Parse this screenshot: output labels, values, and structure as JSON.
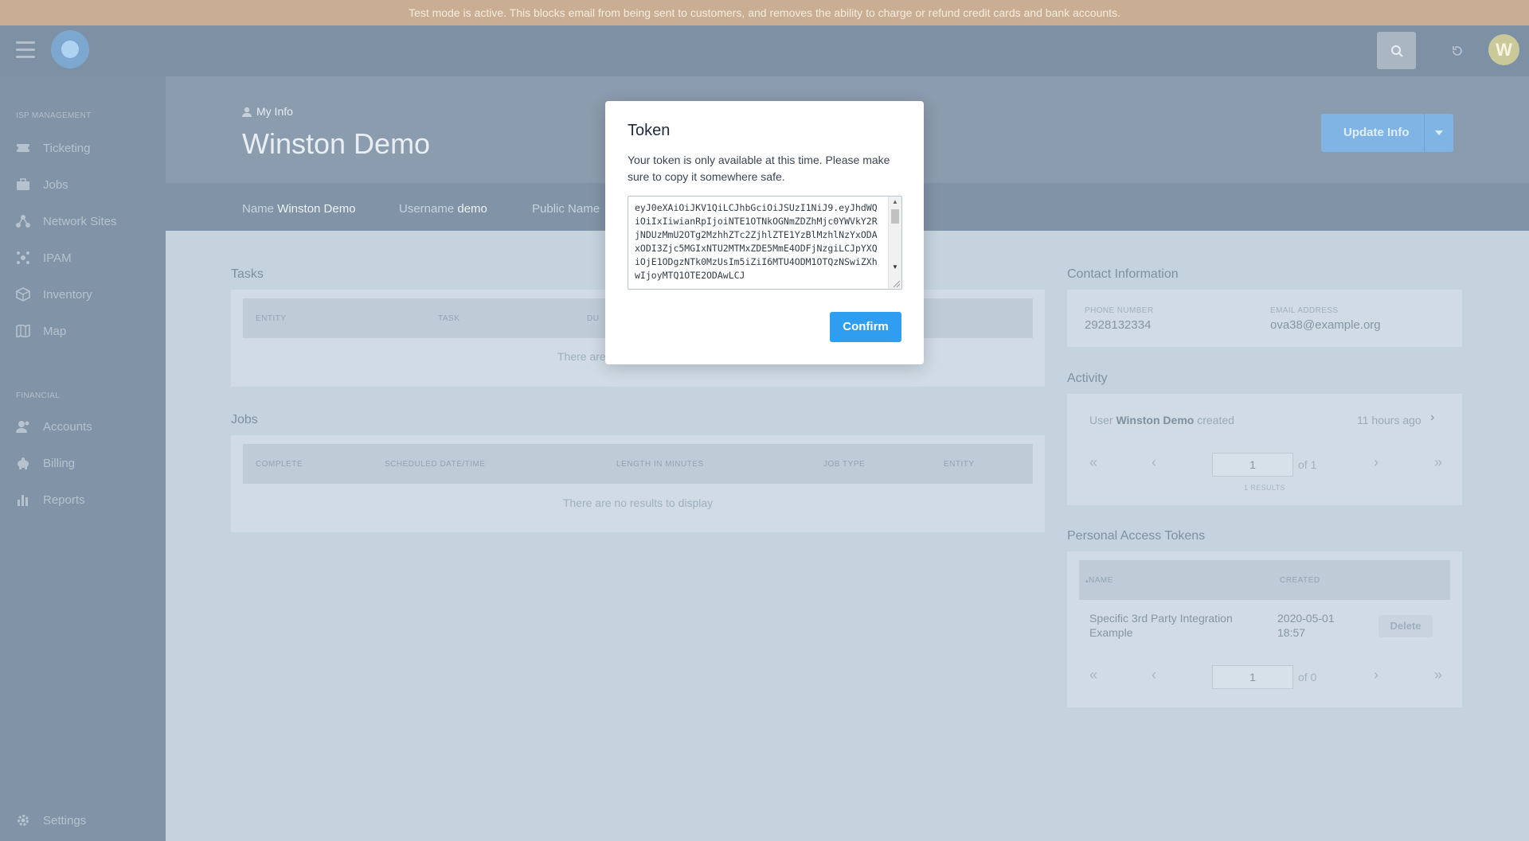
{
  "banner": {
    "text": "Test mode is active. This blocks email from being sent to customers, and removes the ability to charge or refund credit cards and bank accounts."
  },
  "topbar": {
    "avatar_initial": "W"
  },
  "sidebar": {
    "section_isp": "ISP MANAGEMENT",
    "isp_items": [
      {
        "label": "Ticketing",
        "icon": "ticket-icon"
      },
      {
        "label": "Jobs",
        "icon": "briefcase-icon"
      },
      {
        "label": "Network Sites",
        "icon": "network-icon"
      },
      {
        "label": "IPAM",
        "icon": "ipam-icon"
      },
      {
        "label": "Inventory",
        "icon": "box-icon"
      },
      {
        "label": "Map",
        "icon": "map-icon"
      }
    ],
    "section_financial": "FINANCIAL",
    "financial_items": [
      {
        "label": "Accounts",
        "icon": "users-icon"
      },
      {
        "label": "Billing",
        "icon": "piggy-bank-icon"
      },
      {
        "label": "Reports",
        "icon": "bar-chart-icon"
      }
    ],
    "settings": {
      "label": "Settings",
      "icon": "gear-icon"
    }
  },
  "header": {
    "breadcrumb": "My Info",
    "title": "Winston Demo",
    "update_button": "Update Info"
  },
  "meta": {
    "name_label": "Name",
    "name_value": "Winston Demo",
    "username_label": "Username",
    "username_value": "demo",
    "public_name_label": "Public Name"
  },
  "tasks": {
    "title": "Tasks",
    "columns": [
      "ENTITY",
      "TASK",
      "DU"
    ],
    "empty": "There are"
  },
  "jobs": {
    "title": "Jobs",
    "columns": [
      "COMPLETE",
      "SCHEDULED DATE/TIME",
      "LENGTH IN MINUTES",
      "JOB TYPE",
      "ENTITY"
    ],
    "empty": "There are no results to display"
  },
  "contact": {
    "title": "Contact Information",
    "phone_label": "PHONE NUMBER",
    "phone_value": "2928132334",
    "email_label": "EMAIL ADDRESS",
    "email_value": "ova38@example.org"
  },
  "activity": {
    "title": "Activity",
    "entry_prefix": "User",
    "entry_user": "Winston Demo",
    "entry_suffix": "created",
    "entry_time": "11 hours ago",
    "page_value": "1",
    "page_of": "of 1",
    "results": "1 RESULTS"
  },
  "tokens": {
    "title": "Personal Access Tokens",
    "columns": [
      "NAME",
      "CREATED"
    ],
    "rows": [
      {
        "name": "Specific 3rd Party Integration Example",
        "created": "2020-05-01 18:57",
        "action": "Delete"
      }
    ],
    "page_value": "1",
    "page_of": "of 0"
  },
  "modal": {
    "title": "Token",
    "message": "Your token is only available at this time. Please make sure to copy it somewhere safe.",
    "token": "eyJ0eXAiOiJKV1QiLCJhbGciOiJSUzI1NiJ9.eyJhdWQiOiIxIiwianRpIjoiNTE1OTNkOGNmZDZhMjc0YWVkY2RjNDUzMmU2OTg2MzhhZTc2ZjhlZTE1YzBlMzhlNzYxODAxODI3Zjc5MGIxNTU2MTMxZDE5MmE4ODFjNzgiLCJpYXQiOjE1ODgzNTk0MzUsIm5iZiI6MTU4ODM1OTQzNSwiZXhwIjoyMTQ1OTE2ODAwLCJ",
    "confirm": "Confirm"
  },
  "colors": {
    "banner": "#c9ae93",
    "sidebar": "#8193a6",
    "accent": "#2f9ef0",
    "overlay_bg": "#c5d3df"
  }
}
